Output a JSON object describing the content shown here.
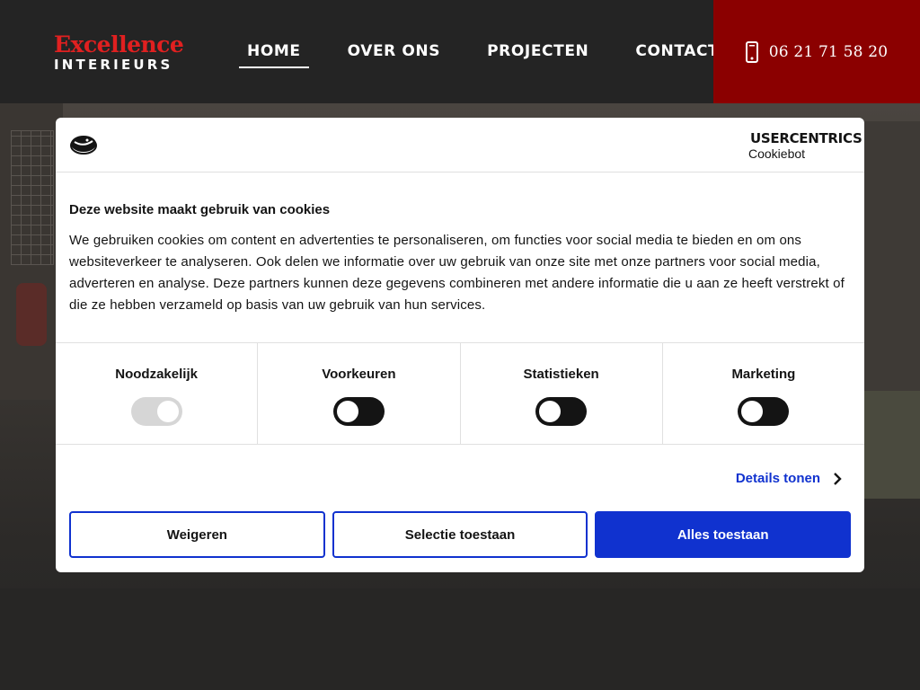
{
  "header": {
    "logo_top": "Excellence",
    "logo_bottom": "INTERIEURS",
    "nav": [
      {
        "label": "HOME",
        "active": true
      },
      {
        "label": "OVER ONS"
      },
      {
        "label": "PROJECTEN"
      },
      {
        "label": "CONTACT"
      }
    ],
    "phone": "06 21 71 58 20"
  },
  "colors": {
    "brand_red": "#e02020",
    "phone_bg": "#8b0000",
    "header_bg": "#242424",
    "accent_blue": "#1032cf"
  },
  "cookie_dialog": {
    "provider_brand": "USERCENTRICS",
    "provider_product": "Cookiebot",
    "title": "Deze website maakt gebruik van cookies",
    "text": "We gebruiken cookies om content en advertenties te personaliseren, om functies voor social media te bieden en om ons websiteverkeer te analyseren. Ook delen we informatie over uw gebruik van onze site met onze partners voor social media, adverteren en analyse. Deze partners kunnen deze gegevens combineren met andere informatie die u aan ze heeft verstrekt of die ze hebben verzameld op basis van uw gebruik van hun services.",
    "categories": [
      {
        "label": "Noodzakelijk",
        "enabled": true,
        "disabled": true
      },
      {
        "label": "Voorkeuren",
        "enabled": false
      },
      {
        "label": "Statistieken",
        "enabled": false
      },
      {
        "label": "Marketing",
        "enabled": false
      }
    ],
    "details_link": "Details tonen",
    "buttons": {
      "reject": "Weigeren",
      "selection": "Selectie toestaan",
      "accept_all": "Alles toestaan"
    }
  }
}
